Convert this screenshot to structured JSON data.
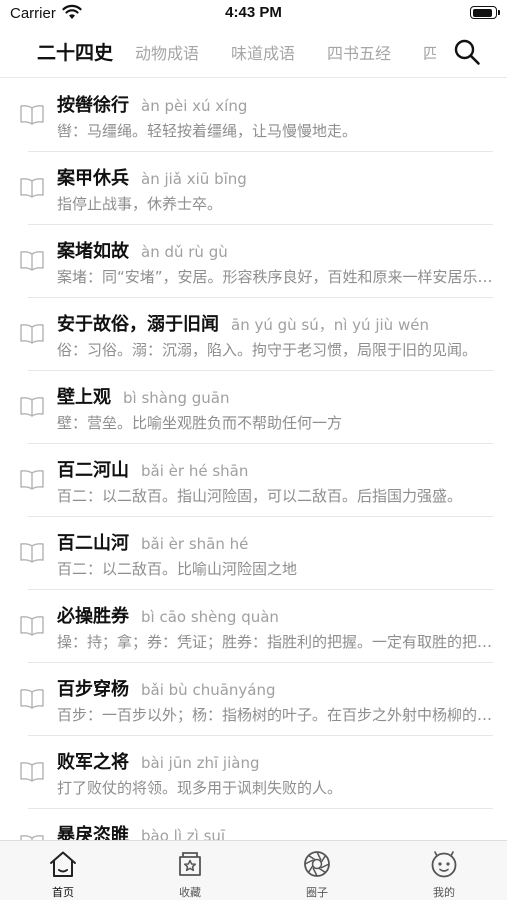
{
  "status": {
    "carrier": "Carrier",
    "time": "4:43 PM",
    "battery_level": 0.9
  },
  "category_tabs": [
    {
      "label": "二十四史",
      "active": true
    },
    {
      "label": "动物成语",
      "active": false
    },
    {
      "label": "味道成语",
      "active": false
    },
    {
      "label": "四书五经",
      "active": false
    },
    {
      "label": "四",
      "active": false
    }
  ],
  "idioms": [
    {
      "title": "按辔徐行",
      "pinyin": "àn pèi xú xíng",
      "desc": "辔：马缰绳。轻轻按着缰绳，让马慢慢地走。"
    },
    {
      "title": "案甲休兵",
      "pinyin": "àn jiǎ xiū bīng",
      "desc": "指停止战事，休养士卒。"
    },
    {
      "title": "案堵如故",
      "pinyin": "àn dǔ rù gù",
      "desc": "案堵：同“安堵”，安居。形容秩序良好，百姓和原来一样安居乐业。"
    },
    {
      "title": "安于故俗，溺于旧闻",
      "pinyin": "ān yú gù sú，nì yú jiù wén",
      "desc": "俗：习俗。溺：沉溺，陷入。拘守于老习惯，局限于旧的见闻。"
    },
    {
      "title": "壁上观",
      "pinyin": "bì shàng guān",
      "desc": "壁：营垒。比喻坐观胜负而不帮助任何一方"
    },
    {
      "title": "百二河山",
      "pinyin": "bǎi èr hé shān",
      "desc": "百二：以二敌百。指山河险固，可以二敌百。后指国力强盛。"
    },
    {
      "title": "百二山河",
      "pinyin": "bǎi èr shān hé",
      "desc": "百二：以二敌百。比喻山河险固之地"
    },
    {
      "title": "必操胜券",
      "pinyin": "bì cāo shèng quàn",
      "desc": "操：持；拿；券：凭证；胜券：指胜利的把握。一定有取胜的把握。"
    },
    {
      "title": "百步穿杨",
      "pinyin": "bǎi bù chuānyáng",
      "desc": "百步：一百步以外；杨：指杨树的叶子。在百步之外射中杨柳的叶子。"
    },
    {
      "title": "败军之将",
      "pinyin": "bài jūn zhī jiàng",
      "desc": "打了败仗的将领。现多用于讽刺失败的人。"
    },
    {
      "title": "暴戾恣睢",
      "pinyin": "bào lì zì suī",
      "desc": ""
    }
  ],
  "bottom_tabs": [
    {
      "label": "首页",
      "icon": "home-icon",
      "active": true
    },
    {
      "label": "收藏",
      "icon": "star-box-icon",
      "active": false
    },
    {
      "label": "圈子",
      "icon": "aperture-icon",
      "active": false
    },
    {
      "label": "我的",
      "icon": "face-icon",
      "active": false
    }
  ]
}
